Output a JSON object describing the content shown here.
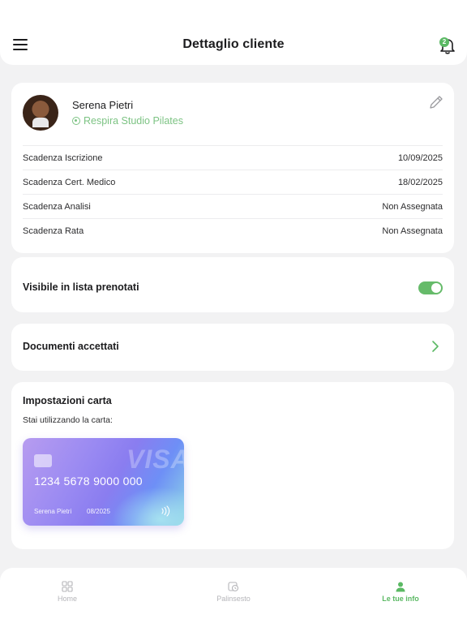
{
  "header": {
    "title": "Dettaglio cliente",
    "notification_count": "2"
  },
  "client": {
    "name": "Serena Pietri",
    "studio": "Respira Studio Pilates",
    "details": [
      {
        "label": "Scadenza Iscrizione",
        "value": "10/09/2025"
      },
      {
        "label": "Scadenza Cert. Medico",
        "value": "18/02/2025"
      },
      {
        "label": "Scadenza Analisi",
        "value": "Non Assegnata"
      },
      {
        "label": "Scadenza Rata",
        "value": "Non Assegnata"
      }
    ]
  },
  "visibility": {
    "label": "Visibile in lista prenotati",
    "enabled": true
  },
  "documents": {
    "label": "Documenti accettati"
  },
  "card_settings": {
    "title": "Impostazioni carta",
    "subtitle": "Stai utilizzando la carta:",
    "card": {
      "brand": "VISA",
      "number": "1234 5678 9000 000",
      "holder": "Serena Pietri",
      "expiry": "08/2025"
    }
  },
  "tabs": [
    {
      "label": "Home",
      "icon": "grid-icon"
    },
    {
      "label": "Palinsesto",
      "icon": "calendar-clock-icon"
    },
    {
      "label": "Le tue info",
      "icon": "user-icon",
      "active": true
    }
  ],
  "colors": {
    "accent": "#5bb964",
    "background": "#f2f2f3",
    "card": "#ffffff"
  }
}
